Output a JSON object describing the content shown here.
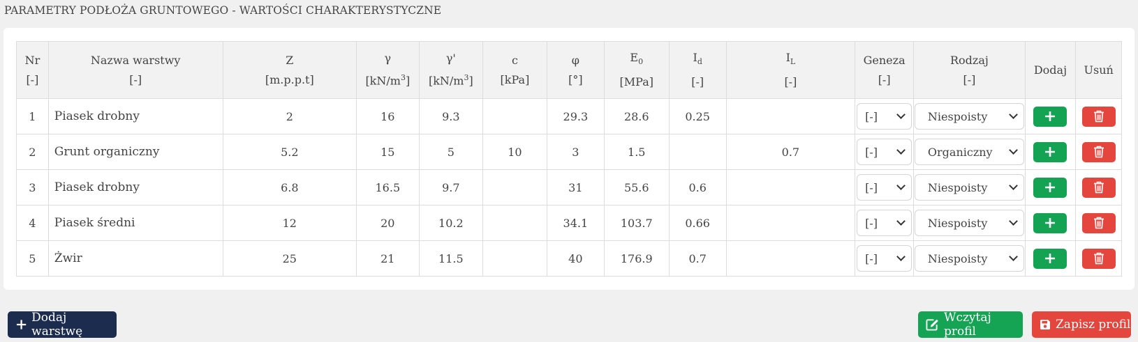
{
  "page_title": "PARAMETRY PODŁOŻA GRUNTOWEGO - WARTOŚCI CHARAKTERYSTYCZNE",
  "table": {
    "headers": [
      {
        "label": "Nr",
        "unit": "[-]"
      },
      {
        "label": "Nazwa warstwy",
        "unit": "[-]"
      },
      {
        "label": "Z",
        "unit": "[m.p.p.t]"
      },
      {
        "label": "γ",
        "unit": "[kN/m",
        "unit_sup": "3",
        "unit_end": "]"
      },
      {
        "label": "γ'",
        "unit": "[kN/m",
        "unit_sup": "3",
        "unit_end": "]"
      },
      {
        "label": "c",
        "unit": "[kPa]"
      },
      {
        "label": "φ",
        "unit": "[°]"
      },
      {
        "label": "E",
        "label_sub": "0",
        "unit": "[MPa]"
      },
      {
        "label": "I",
        "label_sub": "d",
        "unit": "[-]"
      },
      {
        "label": "I",
        "label_sub": "L",
        "unit": "[-]"
      },
      {
        "label": "Geneza",
        "unit": "[-]"
      },
      {
        "label": "Rodzaj",
        "unit": "[-]"
      },
      {
        "label": "Dodaj"
      },
      {
        "label": "Usuń"
      }
    ],
    "rows": [
      {
        "nr": "1",
        "name": "Piasek drobny",
        "z": "2",
        "gamma": "16",
        "gamma_prime": "9.3",
        "c": "",
        "phi": "29.3",
        "e0": "28.6",
        "id": "0.25",
        "il": "",
        "geneza": "[-]",
        "rodzaj": "Niespoisty"
      },
      {
        "nr": "2",
        "name": "Grunt organiczny",
        "z": "5.2",
        "gamma": "15",
        "gamma_prime": "5",
        "c": "10",
        "phi": "3",
        "e0": "1.5",
        "id": "",
        "il": "0.7",
        "geneza": "[-]",
        "rodzaj": "Organiczny"
      },
      {
        "nr": "3",
        "name": "Piasek drobny",
        "z": "6.8",
        "gamma": "16.5",
        "gamma_prime": "9.7",
        "c": "",
        "phi": "31",
        "e0": "55.6",
        "id": "0.6",
        "il": "",
        "geneza": "[-]",
        "rodzaj": "Niespoisty"
      },
      {
        "nr": "4",
        "name": "Piasek średni",
        "z": "12",
        "gamma": "20",
        "gamma_prime": "10.2",
        "c": "",
        "phi": "34.1",
        "e0": "103.7",
        "id": "0.66",
        "il": "",
        "geneza": "[-]",
        "rodzaj": "Niespoisty"
      },
      {
        "nr": "5",
        "name": "Żwir",
        "z": "25",
        "gamma": "21",
        "gamma_prime": "11.5",
        "c": "",
        "phi": "40",
        "e0": "176.9",
        "id": "0.7",
        "il": "",
        "geneza": "[-]",
        "rodzaj": "Niespoisty"
      }
    ]
  },
  "buttons": {
    "add_layer": "Dodaj warstwę",
    "load_profile": "Wczytaj profil",
    "save_profile": "Zapisz profil"
  },
  "colors": {
    "green": "#14a352",
    "red": "#e4453c",
    "navy": "#1c2c4f"
  },
  "icons": {
    "add": "plus-icon",
    "delete": "trash-icon",
    "load": "edit-icon",
    "save": "floppy-disk-icon"
  }
}
